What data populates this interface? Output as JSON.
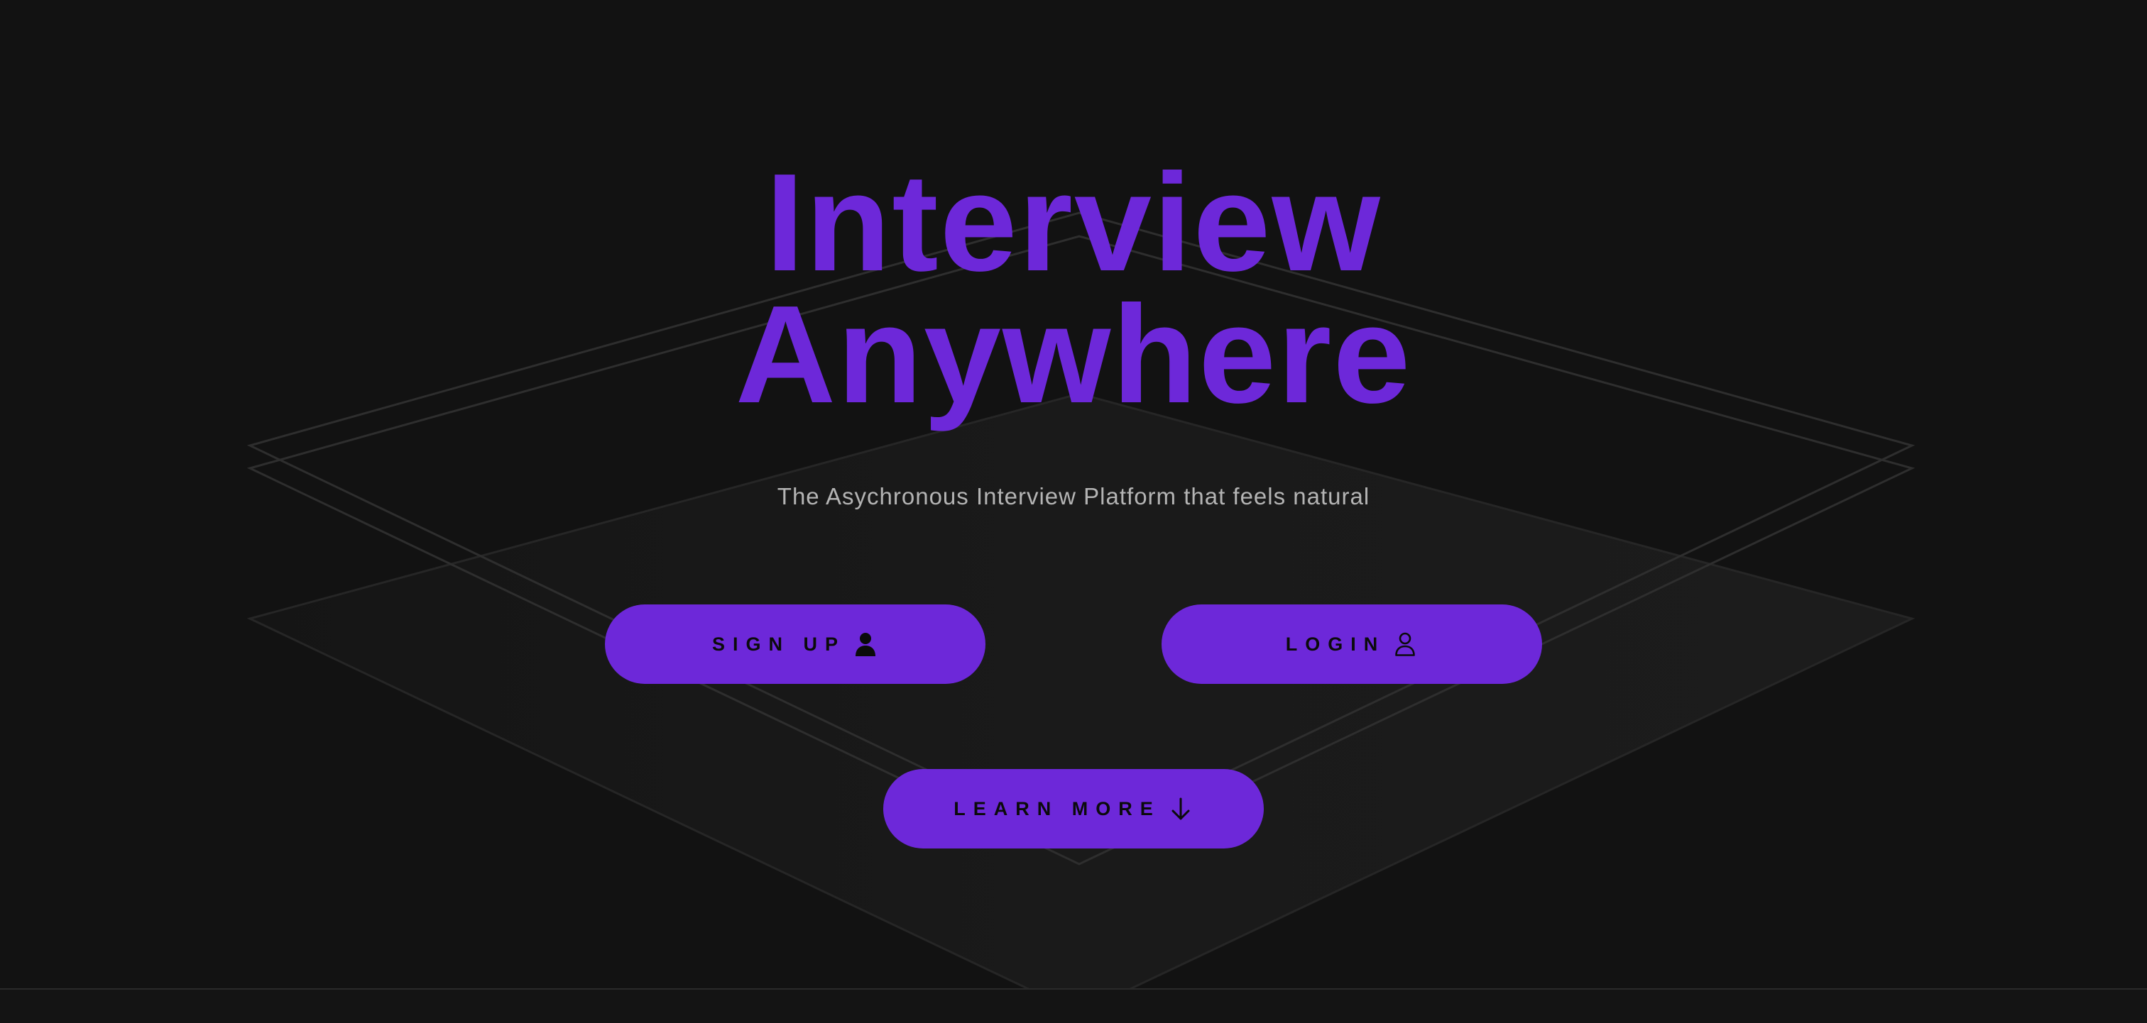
{
  "theme": {
    "background": "#121212",
    "accent": "#6d28d9",
    "headline_color": "#6d28d9",
    "tagline_color": "#b4b4b4",
    "button_text_color": "#0b0b0b",
    "outline_color": "#333333"
  },
  "hero": {
    "title_line_1": "Interview",
    "title_line_2": "Anywhere",
    "tagline": "The Asychronous Interview Platform that feels natural"
  },
  "buttons": {
    "signup": {
      "label": "SIGN UP",
      "icon": "user-filled-icon"
    },
    "login": {
      "label": "LOGIN",
      "icon": "user-outline-icon"
    },
    "learn_more": {
      "label": "LEARN MORE",
      "icon": "arrow-down-icon"
    }
  }
}
